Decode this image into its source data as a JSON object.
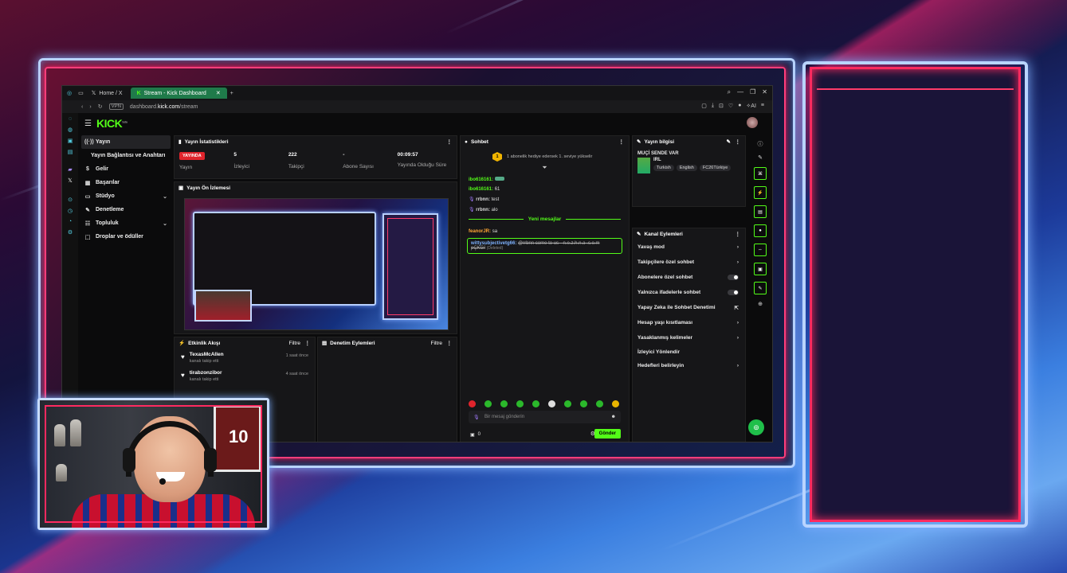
{
  "browser": {
    "tabs": [
      {
        "label": "Home / X",
        "icon": "x-logo-icon"
      },
      {
        "label": "Stream - Kick Dashboard",
        "icon": "kick-favicon-icon",
        "active": true
      }
    ],
    "url_prefix": "dashboard.",
    "url_domain": "kick.com",
    "url_path": "/stream",
    "vpn_label": "VPN"
  },
  "app": {
    "logo": "KICK",
    "logo_sup": "beta"
  },
  "nav": [
    {
      "label": "Yayın",
      "icon": "broadcast-icon",
      "active": true
    },
    {
      "label": "Yayın Bağlantısı ve Anahtarı",
      "icon": ""
    },
    {
      "label": "Gelir",
      "icon": "dollar-icon"
    },
    {
      "label": "Başarılar",
      "icon": "trophy-icon"
    },
    {
      "label": "Stüdyo",
      "icon": "studio-icon",
      "chevron": true
    },
    {
      "label": "Denetleme",
      "icon": "wrench-icon"
    },
    {
      "label": "Topluluk",
      "icon": "community-icon",
      "chevron": true
    },
    {
      "label": "Droplar ve ödüller",
      "icon": "gift-icon"
    }
  ],
  "stats": {
    "title": "Yayın İstatistikleri",
    "live_badge": "YAYINDA",
    "live_label": "Yayın",
    "items": [
      {
        "value": "5",
        "label": "İzleyici"
      },
      {
        "value": "222",
        "label": "Takipçi"
      },
      {
        "value": "-",
        "label": "Abone Sayısı"
      },
      {
        "value": "00:09:57",
        "label": "Yayında Olduğu Süre"
      }
    ]
  },
  "preview": {
    "title": "Yayın Ön İzlemesi"
  },
  "activity": {
    "title": "Etkinlik Akışı",
    "filter": "Filtre",
    "items": [
      {
        "name": "TexasMcAllen",
        "sub": "kanalı takip etti",
        "time": "1 saat önce"
      },
      {
        "name": "tirabzonzibor",
        "sub": "kanalı takip etti",
        "time": "4 saat önce"
      }
    ]
  },
  "moderation": {
    "title": "Denetim Eylemleri",
    "filter": "Filtre"
  },
  "chat": {
    "title": "Sohbet",
    "goal_badge": "1",
    "goal_text": "1 abonelik hediye edersek 1. seviye yükselir",
    "messages": [
      {
        "user": "ibo616161:",
        "text": "",
        "color": "green"
      },
      {
        "user": "ibo616161:",
        "text": "61",
        "color": "green"
      },
      {
        "user": "rrbnn:",
        "text": "test",
        "color": "white"
      },
      {
        "user": "rrbnn:",
        "text": "alo",
        "color": "white"
      }
    ],
    "new_messages": "Yeni mesajlar",
    "after": [
      {
        "user": "feanorJR:",
        "text": "sa",
        "color": "orange"
      }
    ],
    "highlight_user": "wittysubjectivetg66:",
    "highlight_text": "@rrbnn come to us - n.e.z.h.n.a .c.o.m",
    "highlight_text2": "pÇKGİ",
    "highlight_deleted": "(Deleted)",
    "input_placeholder": "Bir mesaj gönderin",
    "count": "0",
    "send": "Gönder"
  },
  "info": {
    "title": "Yayın bilgisi",
    "stream_title": "MUÇİ SENDE VAR",
    "category": "IRL",
    "tags": [
      "Turkish",
      "English",
      "FC26Türkiye"
    ]
  },
  "channel": {
    "title": "Kanal Eylemleri",
    "rows": [
      {
        "label": "Yavaş mod",
        "kind": "chevron"
      },
      {
        "label": "Takipçilere özel sohbet",
        "kind": "chevron"
      },
      {
        "label": "Abonelere özel sohbet",
        "kind": "toggle"
      },
      {
        "label": "Yalnızca ifadelerle sohbet",
        "kind": "toggle"
      },
      {
        "label": "Yapay Zeka ile Sohbet Denetimi",
        "kind": "external"
      },
      {
        "label": "Hesap yaşı kısıtlaması",
        "kind": "chevron"
      },
      {
        "label": "Yasaklanmış kelimeler",
        "kind": "chevron"
      },
      {
        "label": "İzleyici Yönlendir",
        "kind": "none"
      },
      {
        "label": "Hedefleri belirleyin",
        "kind": "chevron"
      }
    ]
  },
  "preview_jersey_number": "10",
  "colors": {
    "kick_green": "#53fc18",
    "live_red": "#e0242c",
    "neon_pink": "#ff2a60",
    "neon_blue": "#b9d4ff"
  }
}
